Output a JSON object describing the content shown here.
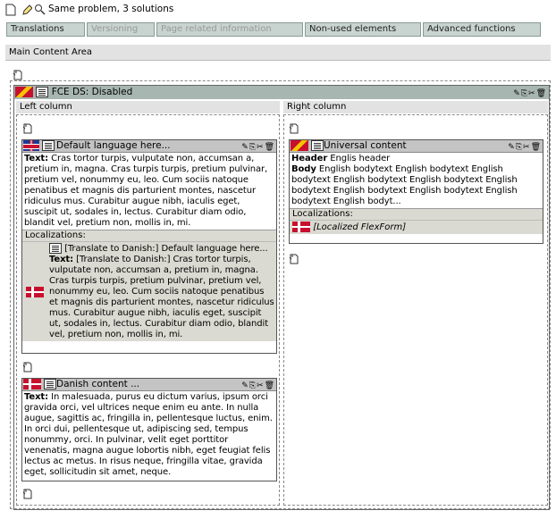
{
  "topbar": {
    "title": "Same problem, 3 solutions"
  },
  "tabs": [
    {
      "label": "Translations",
      "state": "active"
    },
    {
      "label": "Versioning",
      "state": "disabled"
    },
    {
      "label": "Page related information",
      "state": "disabled"
    },
    {
      "label": "Non-used elements",
      "state": "active"
    },
    {
      "label": "Advanced functions",
      "state": "active"
    }
  ],
  "main": {
    "label": "Main Content Area"
  },
  "fce": {
    "header": "FCE DS: Disabled"
  },
  "left": {
    "label": "Left column"
  },
  "right": {
    "label": "Right column"
  },
  "default_box": {
    "title": "Default language here...",
    "text_label": "Text:",
    "text": "Cras tortor turpis, vulputate non, accumsan a, pretium in, magna. Cras turpis turpis, pretium pulvinar, pretium vel, nonummy eu, leo. Cum sociis natoque penatibus et magnis dis parturient montes, nascetur ridiculus mus. Curabitur augue nibh, iaculis eget, suscipit ut, sodales in, lectus. Curabitur diam odio, blandit vel, pretium non, mollis in, mi.",
    "localizations_label": "Localizations:",
    "loc_title": "[Translate to Danish:] Default language here...",
    "loc_text_label": "Text:",
    "loc_text": "[Translate to Danish:] Cras tortor turpis, vulputate non, accumsan a, pretium in, magna. Cras turpis turpis, pretium pulvinar, pretium vel, nonummy eu, leo. Cum sociis natoque penatibus et magnis dis parturient montes, nascetur ridiculus mus. Curabitur augue nibh, iaculis eget, suscipit ut, sodales in, lectus. Curabitur diam odio, blandit vel, pretium non, mollis in, mi."
  },
  "danish_box": {
    "title": "Danish content ...",
    "text_label": "Text:",
    "text": "In malesuada, purus eu dictum varius, ipsum orci gravida orci, vel ultrices neque enim eu ante. In nulla augue, sagittis ac, fringilla in, pellentesque luctus, enim. In orci dui, pellentesque ut, adipiscing sed, tempus nonummy, orci. In pulvinar, velit eget porttitor venenatis, magna augue lobortis nibh, eget feugiat felis lectus ac metus. In risus neque, fringilla vitae, gravida eget, sollicitudin sit amet, neque."
  },
  "universal_box": {
    "title": "Universal content",
    "header_label": "Header",
    "header_text": "Englis header",
    "body_label": "Body",
    "body_text": "English bodytext English bodytext English bodytext English bodytext English bodytext English bodytext English bodytext English bodytext English bodytext English bodyt...",
    "localizations_label": "Localizations:",
    "loc_item": "[Localized FlexForm]"
  },
  "colors": {
    "tab_bg": "#c8d4d0",
    "fce_header": "#a8b6b2",
    "box_header": "#c4c4c4",
    "localization_bg": "#dadad2"
  },
  "icons": [
    "page-icon",
    "edit-icon",
    "search-icon",
    "new-record-icon",
    "document-icon",
    "copy-icon",
    "cut-icon",
    "delete-icon",
    "danish-flag-icon",
    "uk-flag-icon",
    "multilang-flag-icon"
  ]
}
